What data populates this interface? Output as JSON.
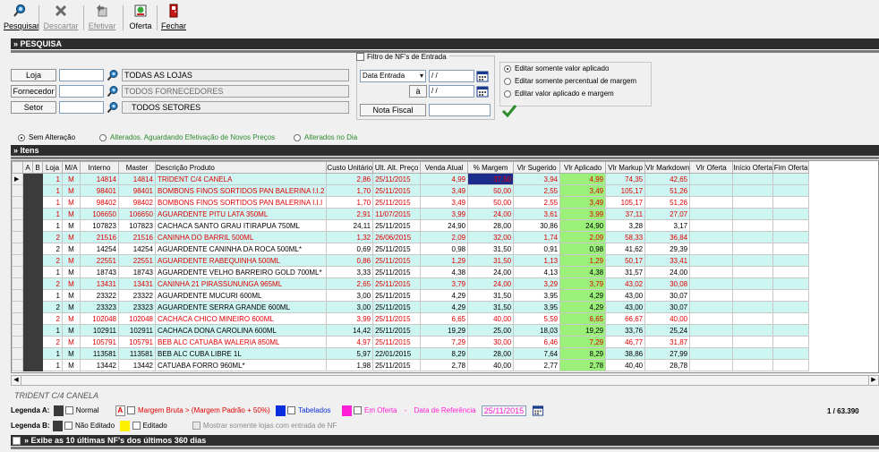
{
  "toolbar": {
    "pesquisar": "Pesquisar",
    "descartar": "Descartar",
    "efetivar": "Efetivar",
    "oferta": "Oferta",
    "fechar": "Fechar"
  },
  "sections": {
    "pesquisa": "» PESQUISA",
    "itens": "» Itens",
    "nfs": "» Exibe as 10 últimas NF's dos últimos 360 dias"
  },
  "filters": {
    "loja_label": "Loja",
    "loja_value": "",
    "loja_desc": "TODAS AS LOJAS",
    "fornecedor_label": "Fornecedor",
    "fornecedor_value": "",
    "fornecedor_desc": "TODOS FORNECEDORES",
    "setor_label": "Setor",
    "setor_value": "",
    "setor_desc": "TODOS SETORES"
  },
  "nf_filter": {
    "title": "Filtro de NF's de Entrada",
    "date_type": "Data Entrada",
    "date_from": " / /",
    "to_label": "à",
    "date_to": " / /",
    "nota_label": "Nota Fiscal",
    "nota_value": ""
  },
  "edit_options": [
    "Editar somente valor aplicado",
    "Editar somente percentual de margem",
    "Editar valor aplicado e margem"
  ],
  "status_options": [
    "Sem Alteração",
    "Alterados. Aguardando Efetivação de Novos Preços",
    "Alterados no Dia"
  ],
  "grid": {
    "columns": [
      "A",
      "B",
      "Loja",
      "M/A",
      "Interno",
      "Master",
      "Descrição Produto",
      "Custo Unitário",
      "Ult. Alt. Preço",
      "Venda Atual",
      "% Margem",
      "Vlr Sugerido",
      "Vlr Aplicado",
      "Vlr Markup",
      "Vlr Markdown",
      "Vlr Oferta",
      "Início Oferta",
      "Fim Oferta"
    ],
    "rows": [
      {
        "loja": "1",
        "ma": "M",
        "interno": "14814",
        "master": "14814",
        "desc": "TRIDENT C/4 CANELA",
        "custo": "2,86",
        "ult": "25/11/2015",
        "venda": "4,99",
        "margem": "37,50",
        "sug": "3,94",
        "apl": "4,99",
        "markup": "74,35",
        "markdown": "42,65",
        "color": "red",
        "bg": "cyan"
      },
      {
        "loja": "1",
        "ma": "M",
        "interno": "98401",
        "master": "98401",
        "desc": "BOMBONS FINOS SORTIDOS PAN BALERINA I.I.2",
        "custo": "1,70",
        "ult": "25/11/2015",
        "venda": "3,49",
        "margem": "50,00",
        "sug": "2,55",
        "apl": "3,49",
        "markup": "105,17",
        "markdown": "51,26",
        "color": "red",
        "bg": "cyan"
      },
      {
        "loja": "1",
        "ma": "M",
        "interno": "98402",
        "master": "98402",
        "desc": "BOMBONS FINOS SORTIDOS PAN BALERINA I.I.I",
        "custo": "1,70",
        "ult": "25/11/2015",
        "venda": "3,49",
        "margem": "50,00",
        "sug": "2,55",
        "apl": "3,49",
        "markup": "105,17",
        "markdown": "51,26",
        "color": "red",
        "bg": "white"
      },
      {
        "loja": "1",
        "ma": "M",
        "interno": "106650",
        "master": "106650",
        "desc": "AGUARDENTE PITU LATA 350ML",
        "custo": "2,91",
        "ult": "11/07/2015",
        "venda": "3,99",
        "margem": "24,00",
        "sug": "3,61",
        "apl": "3,99",
        "markup": "37,11",
        "markdown": "27,07",
        "color": "red",
        "bg": "cyan"
      },
      {
        "loja": "1",
        "ma": "M",
        "interno": "107823",
        "master": "107823",
        "desc": "CACHACA SANTO GRAU ITIRAPUA  750ML",
        "custo": "24,11",
        "ult": "25/11/2015",
        "venda": "24,90",
        "margem": "28,00",
        "sug": "30,86",
        "apl": "24,90",
        "markup": "3,28",
        "markdown": "3,17",
        "color": "black",
        "bg": "white"
      },
      {
        "loja": "2",
        "ma": "M",
        "interno": "21516",
        "master": "21516",
        "desc": "CANINHA DO BARRIL 500ML",
        "custo": "1,32",
        "ult": "26/06/2015",
        "venda": "2,09",
        "margem": "32,00",
        "sug": "1,74",
        "apl": "2,09",
        "markup": "58,33",
        "markdown": "36,84",
        "color": "red",
        "bg": "cyan"
      },
      {
        "loja": "2",
        "ma": "M",
        "interno": "14254",
        "master": "14254",
        "desc": "AGUARDENTE CANINHA DA ROCA 500ML*",
        "custo": "0,69",
        "ult": "25/11/2015",
        "venda": "0,98",
        "margem": "31,50",
        "sug": "0,91",
        "apl": "0,98",
        "markup": "41,62",
        "markdown": "29,39",
        "color": "black",
        "bg": "white"
      },
      {
        "loja": "2",
        "ma": "M",
        "interno": "22551",
        "master": "22551",
        "desc": "AGUARDENTE RABEQUINHA 500ML",
        "custo": "0,86",
        "ult": "25/11/2015",
        "venda": "1,29",
        "margem": "31,50",
        "sug": "1,13",
        "apl": "1,29",
        "markup": "50,17",
        "markdown": "33,41",
        "color": "red",
        "bg": "cyan"
      },
      {
        "loja": "1",
        "ma": "M",
        "interno": "18743",
        "master": "18743",
        "desc": "AGUARDENTE VELHO BARREIRO GOLD 700ML*",
        "custo": "3,33",
        "ult": "25/11/2015",
        "venda": "4,38",
        "margem": "24,00",
        "sug": "4,13",
        "apl": "4,38",
        "markup": "31,57",
        "markdown": "24,00",
        "color": "black",
        "bg": "white"
      },
      {
        "loja": "2",
        "ma": "M",
        "interno": "13431",
        "master": "13431",
        "desc": "CANINHA 21 PIRASSUNUNGA 965ML",
        "custo": "2,65",
        "ult": "25/11/2015",
        "venda": "3,79",
        "margem": "24,00",
        "sug": "3,29",
        "apl": "3,79",
        "markup": "43,02",
        "markdown": "30,08",
        "color": "red",
        "bg": "cyan"
      },
      {
        "loja": "1",
        "ma": "M",
        "interno": "23322",
        "master": "23322",
        "desc": "AGUARDENTE MUCURI 600ML",
        "custo": "3,00",
        "ult": "25/11/2015",
        "venda": "4,29",
        "margem": "31,50",
        "sug": "3,95",
        "apl": "4,29",
        "markup": "43,00",
        "markdown": "30,07",
        "color": "black",
        "bg": "white"
      },
      {
        "loja": "2",
        "ma": "M",
        "interno": "23323",
        "master": "23323",
        "desc": "AGUARDENTE SERRA GRANDE 600ML",
        "custo": "3,00",
        "ult": "25/11/2015",
        "venda": "4,29",
        "margem": "31,50",
        "sug": "3,95",
        "apl": "4,29",
        "markup": "43,00",
        "markdown": "30,07",
        "color": "black",
        "bg": "cyan"
      },
      {
        "loja": "2",
        "ma": "M",
        "interno": "102048",
        "master": "102048",
        "desc": "CACHACA CHICO MINEIRO 600ML",
        "custo": "3,99",
        "ult": "25/11/2015",
        "venda": "6,65",
        "margem": "40,00",
        "sug": "5,59",
        "apl": "6,65",
        "markup": "66,67",
        "markdown": "40,00",
        "color": "red",
        "bg": "white"
      },
      {
        "loja": "1",
        "ma": "M",
        "interno": "102911",
        "master": "102911",
        "desc": "CACHACA DONA CAROLINA 600ML",
        "custo": "14,42",
        "ult": "25/11/2015",
        "venda": "19,29",
        "margem": "25,00",
        "sug": "18,03",
        "apl": "19,29",
        "markup": "33,76",
        "markdown": "25,24",
        "color": "black",
        "bg": "cyan"
      },
      {
        "loja": "2",
        "ma": "M",
        "interno": "105791",
        "master": "105791",
        "desc": "BEB ALC CATUABA WALERIA 850ML",
        "custo": "4,97",
        "ult": "25/11/2015",
        "venda": "7,29",
        "margem": "30,00",
        "sug": "6,46",
        "apl": "7,29",
        "markup": "46,77",
        "markdown": "31,87",
        "color": "red",
        "bg": "white"
      },
      {
        "loja": "1",
        "ma": "M",
        "interno": "113581",
        "master": "113581",
        "desc": "BEB ALC CUBA LIBRE 1L",
        "custo": "5,97",
        "ult": "22/01/2015",
        "venda": "8,29",
        "margem": "28,00",
        "sug": "7,64",
        "apl": "8,29",
        "markup": "38,86",
        "markdown": "27,99",
        "color": "black",
        "bg": "cyan"
      },
      {
        "loja": "1",
        "ma": "M",
        "interno": "13442",
        "master": "13442",
        "desc": "CATUABA FORRO 960ML*",
        "custo": "1,98",
        "ult": "25/11/2015",
        "venda": "2,78",
        "margem": "40,00",
        "sug": "2,77",
        "apl": "2,78",
        "markup": "40,40",
        "markdown": "28,78",
        "color": "black",
        "bg": "white"
      }
    ]
  },
  "selected_product": "TRIDENT C/4 CANELA",
  "legend_a": {
    "label": "Legenda A:",
    "normal": "Normal",
    "letter": "A",
    "margem_bruta": "Margem Bruta > (Margem Padrão + 50%)",
    "tabelados": "Tabelados",
    "em_oferta": "Em Oferta",
    "dash": "-",
    "data_ref_label": "Data de Referência",
    "data_ref": "25/11/2015"
  },
  "legend_b": {
    "label": "Legenda B:",
    "nao_editado": "Não Editado",
    "editado": "Editado",
    "mostrar": "Mostrar somente lojas com entrada de NF"
  },
  "record_count": "1 / 63.390",
  "colors": {
    "cyan_row": "#cdf5f2",
    "green_cell": "#9bf07a",
    "red_text": "#e00000",
    "selected_cell": "#1a2c8c",
    "tabelados": "#0b2fe0",
    "em_oferta": "#ff1fd6",
    "editado": "#ffef00"
  }
}
